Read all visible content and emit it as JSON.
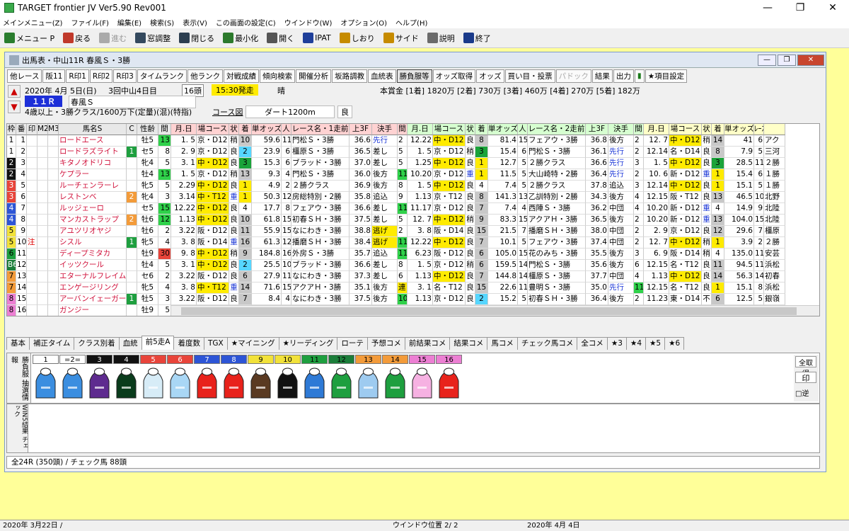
{
  "window": {
    "title": "TARGET frontier JV  Ver5.90  Rev001"
  },
  "menu": [
    "メインメニュー(Z)",
    "ファイル(F)",
    "編集(E)",
    "検索(S)",
    "表示(V)",
    "この画面の設定(C)",
    "ウインドウ(W)",
    "オプション(O)",
    "ヘルプ(H)"
  ],
  "toolbar": [
    {
      "label": "メニュー P",
      "icon": "menu-icon",
      "color": "#2a7d2e"
    },
    {
      "label": "戻る",
      "icon": "back-arrow-icon",
      "color": "#c0392b"
    },
    {
      "label": "進む",
      "icon": "forward-arrow-icon",
      "color": "#aaaaaa",
      "disabled": true
    },
    {
      "label": "窓調整",
      "icon": "window-adjust-icon",
      "color": "#34495e"
    },
    {
      "label": "閉じる",
      "icon": "close-window-icon",
      "color": "#2c3e50"
    },
    {
      "label": "最小化",
      "icon": "minimize-icon",
      "color": "#2c7a2c"
    },
    {
      "label": "開く",
      "icon": "open-icon",
      "color": "#555555"
    },
    {
      "label": "IPAT",
      "icon": "ipat-icon",
      "color": "#1f3f9a"
    },
    {
      "label": "しおり",
      "icon": "bookmark-icon",
      "color": "#c68b00"
    },
    {
      "label": "サイド",
      "icon": "side-icon",
      "color": "#c68b00"
    },
    {
      "label": "説明",
      "icon": "help-icon",
      "color": "#6b6b6b"
    },
    {
      "label": "終了",
      "icon": "exit-icon",
      "color": "#1a3a8a"
    }
  ],
  "child": {
    "title": "出馬表・中山11R 春風Ｓ・3勝"
  },
  "buttons": [
    "他レース",
    "阪11",
    "R印1",
    "R印2",
    "R印3",
    "タイムランク",
    "他ランク",
    "対戦成績",
    "傾向検索",
    "開催分析",
    "坂路調教",
    "血統表",
    "勝負服等",
    "オッズ取得",
    "オッズ",
    "買い目・投票",
    "パドック",
    "結果",
    "出力",
    "★項目設定"
  ],
  "race": {
    "date": "2020年 4月 5日(日)",
    "kai": "3回中山4日目",
    "heads": "16頭",
    "post": "15:30発走",
    "weather": "晴",
    "rno": "１１Ｒ",
    "name": "春風Ｓ",
    "cond": "4歳以上・3勝クラス/1600万下(定量)(混)(特指)",
    "course_label": "コース図",
    "course": "ダート1200m",
    "baba": "良",
    "prize": "本賞金 [1着] 1820万 [2着] 730万 [3着] 460万 [4着] 270万 [5着] 182万"
  },
  "colors": {
    "waku": [
      "#ffffff",
      "#ffffff",
      "#111111",
      "#111111",
      "#e8443a",
      "#e8443a",
      "#2d55d6",
      "#2d55d6",
      "#f2e23a",
      "#f2e23a",
      "#1e9f3f",
      "#1b7e3a",
      "#f39b3a",
      "#f39b3a",
      "#ec7fd3",
      "#ec7fd3"
    ]
  },
  "columns": {
    "left": [
      "枠",
      "番",
      "印",
      "M2",
      "M3",
      "馬名S",
      "C",
      "性齢",
      "間"
    ],
    "past1": [
      "月.日",
      "場コース",
      "状",
      "着",
      "単オッズ",
      "人",
      "レース名・1走前",
      "上3F",
      "決手",
      "間"
    ],
    "past2": [
      "月.日",
      "場コース",
      "状",
      "着",
      "単オッズ",
      "人",
      "レース名・2走前",
      "上3F",
      "決手",
      "間"
    ],
    "past3": [
      "月.日",
      "場コース",
      "状",
      "着",
      "単オッズ",
      "ﾚｰｽ"
    ]
  },
  "horses": [
    {
      "waku": "1",
      "ban": "1",
      "mark": "",
      "name": "ロードエース",
      "c": "",
      "sex": "牡5",
      "iv": "13",
      "p1": [
        "1. 5",
        "京・D12",
        "稍",
        "10",
        "59.6",
        "11",
        "門松Ｓ・3勝",
        "36.6",
        "先行",
        "2"
      ],
      "p2": [
        "12.22",
        "中・D12",
        "良",
        "8",
        "81.4",
        "15",
        "フェアウ・3勝",
        "36.8",
        "後方",
        "2"
      ],
      "p3": [
        "12. 7",
        "中・D12",
        "稍",
        "14",
        "41",
        "6",
        "アク"
      ]
    },
    {
      "waku": "1",
      "ban": "2",
      "mark": "",
      "name": "ロードラズライト",
      "c": "1",
      "sex": "セ5",
      "iv": "8",
      "p1": [
        "2. 9",
        "京・D12",
        "良",
        "2",
        "23.9",
        "6",
        "橿原Ｓ・3勝",
        "36.5",
        "差し",
        "5"
      ],
      "p2": [
        "1. 5",
        "京・D12",
        "稍",
        "3",
        "15.4",
        "6",
        "門松Ｓ・3勝",
        "36.1",
        "先行",
        "2"
      ],
      "p3": [
        "12.14",
        "名・D14",
        "良",
        "8",
        "7.9",
        "5",
        "三河"
      ]
    },
    {
      "waku": "2",
      "ban": "3",
      "mark": "",
      "name": "キタノオドリコ",
      "c": "",
      "sex": "牝4",
      "iv": "5",
      "p1": [
        "3. 1",
        "中・D12",
        "良",
        "3",
        "15.3",
        "6",
        "ブラッド・3勝",
        "37.0",
        "差し",
        "5"
      ],
      "p2": [
        "1.25",
        "中・D12",
        "良",
        "1",
        "12.7",
        "5",
        "２勝クラス",
        "36.6",
        "先行",
        "3"
      ],
      "p3": [
        "1. 5",
        "中・D12",
        "良",
        "3",
        "28.5",
        "11",
        "２勝"
      ]
    },
    {
      "waku": "2",
      "ban": "4",
      "mark": "",
      "name": "ケプラー",
      "c": "",
      "sex": "牡4",
      "iv": "13",
      "p1": [
        "1. 5",
        "京・D12",
        "稍",
        "13",
        "9.3",
        "4",
        "門松Ｓ・3勝",
        "36.0",
        "後方",
        "11"
      ],
      "p2": [
        "10.20",
        "京・D12",
        "重",
        "1",
        "11.5",
        "5",
        "大山崎特・2勝",
        "36.4",
        "先行",
        "2"
      ],
      "p3": [
        "10. 6",
        "新・D12",
        "重",
        "1",
        "15.4",
        "6",
        "１勝"
      ]
    },
    {
      "waku": "3",
      "ban": "5",
      "mark": "",
      "name": "ルーチェンラーレ",
      "c": "",
      "sex": "牝5",
      "iv": "5",
      "p1": [
        "2.29",
        "中・D12",
        "良",
        "1",
        "4.9",
        "2",
        "２勝クラス",
        "36.9",
        "後方",
        "8"
      ],
      "p2": [
        "1. 5",
        "中・D12",
        "良",
        "4",
        "7.4",
        "5",
        "２勝クラス",
        "37.8",
        "追込",
        "3"
      ],
      "p3": [
        "12.14",
        "中・D12",
        "良",
        "1",
        "15.1",
        "5",
        "１勝"
      ]
    },
    {
      "waku": "3",
      "ban": "6",
      "mark": "",
      "name": "レストンベ",
      "c": "2",
      "sex": "牝4",
      "iv": "3",
      "p1": [
        "3.14",
        "中・T12",
        "重",
        "1",
        "50.3",
        "12",
        "房総特別・2勝",
        "35.8",
        "追込",
        "9"
      ],
      "p2": [
        "1.13",
        "京・T12",
        "良",
        "8",
        "141.3",
        "13",
        "乙訓特別・2勝",
        "34.3",
        "後方",
        "4"
      ],
      "p3": [
        "12.15",
        "阪・T12",
        "良",
        "13",
        "46.5",
        "10",
        "北野"
      ]
    },
    {
      "waku": "4",
      "ban": "7",
      "mark": "",
      "name": "ルッジェーロ",
      "c": "",
      "sex": "セ5",
      "iv": "15",
      "p1": [
        "12.22",
        "中・D12",
        "良",
        "4",
        "17.7",
        "8",
        "フェアウ・3勝",
        "36.6",
        "差し",
        "11"
      ],
      "p2": [
        "11.17",
        "京・D12",
        "良",
        "7",
        "7.4",
        "4",
        "西陣Ｓ・3勝",
        "36.2",
        "中団",
        "4"
      ],
      "p3": [
        "10.20",
        "新・D12",
        "重",
        "4",
        "14.9",
        "9",
        "北陸"
      ]
    },
    {
      "waku": "4",
      "ban": "8",
      "mark": "",
      "name": "マンカストラップ",
      "c": "2",
      "sex": "牡6",
      "iv": "12",
      "p1": [
        "1.13",
        "中・D12",
        "良",
        "10",
        "61.8",
        "15",
        "初春ＳＨ・3勝",
        "37.5",
        "差し",
        "5"
      ],
      "p2": [
        "12. 7",
        "中・D12",
        "稍",
        "9",
        "83.3",
        "15",
        "アクアＨ・3勝",
        "36.5",
        "後方",
        "2"
      ],
      "p3": [
        "10.20",
        "新・D12",
        "重",
        "13",
        "104.0",
        "15",
        "北陸"
      ]
    },
    {
      "waku": "5",
      "ban": "9",
      "mark": "",
      "name": "アユツリオヤジ",
      "c": "",
      "sex": "牡6",
      "iv": "2",
      "p1": [
        "3.22",
        "阪・D12",
        "良",
        "11",
        "55.9",
        "15",
        "なにわき・3勝",
        "38.8",
        "逃げ",
        "2"
      ],
      "p2": [
        "3. 8",
        "阪・D14",
        "良",
        "15",
        "21.5",
        "7",
        "播磨ＳＨ・3勝",
        "38.0",
        "中団",
        "2"
      ],
      "p3": [
        "2. 9",
        "京・D12",
        "良",
        "12",
        "29.6",
        "7",
        "橿原"
      ]
    },
    {
      "waku": "5",
      "ban": "10",
      "mark": "注",
      "name": "シスル",
      "c": "1",
      "sex": "牝5",
      "iv": "4",
      "p1": [
        "3. 8",
        "阪・D14",
        "重",
        "16",
        "61.3",
        "12",
        "播磨ＳＨ・3勝",
        "38.4",
        "逃げ",
        "11"
      ],
      "p2": [
        "12.22",
        "中・D12",
        "良",
        "7",
        "10.1",
        "5",
        "フェアウ・3勝",
        "37.4",
        "中団",
        "2"
      ],
      "p3": [
        "12. 7",
        "中・D12",
        "稍",
        "1",
        "3.9",
        "2",
        "２勝"
      ]
    },
    {
      "waku": "6",
      "ban": "11",
      "mark": "",
      "name": "ディープミタカ",
      "c": "",
      "sex": "牡9",
      "iv": "30",
      "p1": [
        "9. 8",
        "中・D12",
        "稍",
        "9",
        "184.8",
        "16",
        "外房Ｓ・3勝",
        "35.7",
        "追込",
        "11"
      ],
      "p2": [
        "6.23",
        "阪・D12",
        "良",
        "6",
        "105.0",
        "15",
        "花のみち・3勝",
        "35.5",
        "後方",
        "3"
      ],
      "p3": [
        "6. 9",
        "阪・D14",
        "稍",
        "4",
        "135.0",
        "11",
        "安芸"
      ]
    },
    {
      "waku": "B6",
      "ban": "12",
      "mark": "",
      "name": "イッツクール",
      "c": "",
      "sex": "牡4",
      "iv": "5",
      "p1": [
        "3. 1",
        "中・D12",
        "良",
        "2",
        "25.5",
        "10",
        "ブラッド・3勝",
        "36.6",
        "差し",
        "8"
      ],
      "p2": [
        "1. 5",
        "京・D12",
        "稍",
        "6",
        "159.5",
        "14",
        "門松Ｓ・3勝",
        "35.6",
        "後方",
        "6"
      ],
      "p3": [
        "12.15",
        "名・T12",
        "良",
        "11",
        "94.5",
        "11",
        "浜松"
      ]
    },
    {
      "waku": "7",
      "ban": "13",
      "mark": "",
      "name": "エターナルフレイム",
      "c": "",
      "sex": "セ6",
      "iv": "2",
      "p1": [
        "3.22",
        "阪・D12",
        "良",
        "6",
        "27.9",
        "11",
        "なにわき・3勝",
        "37.3",
        "差し",
        "6"
      ],
      "p2": [
        "1.13",
        "中・D12",
        "良",
        "7",
        "144.8",
        "14",
        "橿原Ｓ・3勝",
        "37.7",
        "中団",
        "4"
      ],
      "p3": [
        "1.13",
        "中・D12",
        "良",
        "14",
        "56.3",
        "14",
        "初春"
      ]
    },
    {
      "waku": "7",
      "ban": "14",
      "mark": "",
      "name": "エンゲージリング",
      "c": "",
      "sex": "牝5",
      "iv": "4",
      "p1": [
        "3. 8",
        "中・T12",
        "重",
        "14",
        "71.6",
        "15",
        "アクアＨ・3勝",
        "35.1",
        "後方",
        "連"
      ],
      "p2": [
        "3. 1",
        "名・T12",
        "良",
        "15",
        "22.6",
        "11",
        "豊明Ｓ・3勝",
        "35.0",
        "先行",
        "11"
      ],
      "p3": [
        "12.15",
        "名・T12",
        "良",
        "1",
        "15.1",
        "8",
        "浜松"
      ]
    },
    {
      "waku": "8",
      "ban": "15",
      "mark": "",
      "name": "アーバンイェーガー",
      "c": "1",
      "sex": "牡5",
      "iv": "3",
      "p1": [
        "3.22",
        "阪・D12",
        "良",
        "7",
        "8.4",
        "4",
        "なにわき・3勝",
        "37.5",
        "後方",
        "10"
      ],
      "p2": [
        "1.13",
        "京・D12",
        "良",
        "2",
        "15.2",
        "5",
        "初春ＳＨ・3勝",
        "36.4",
        "後方",
        "2"
      ],
      "p3": [
        "11.23",
        "東・D14",
        "不",
        "6",
        "12.5",
        "5",
        "銀嶺"
      ]
    },
    {
      "waku": "8",
      "ban": "16",
      "mark": "",
      "name": "ガンジー",
      "c": "",
      "sex": "牡9",
      "iv": "5",
      "p1": [
        "3. 1",
        "中・D12",
        "良",
        "5",
        "121.0",
        "13",
        "ブラッド・3勝",
        "36.3",
        "後方",
        "6"
      ],
      "p2": [
        "1.18",
        "京・D14",
        "稍",
        "8",
        "179.8",
        "15",
        "羅生門Ｈ・3勝",
        "37.2",
        "中団",
        "2"
      ],
      "p3": [
        "12. 7",
        "中・D12",
        "稍",
        "7",
        "255.2",
        "16",
        "アク"
      ]
    }
  ],
  "tabs": [
    "基本",
    "補正タイム",
    "クラス別着",
    "血統",
    "前5走A",
    "着度数",
    "TGX",
    "★マイニング",
    "★リーディング",
    "ローテ",
    "予想コメ",
    "前結果コメ",
    "結果コメ",
    "馬コメ",
    "チェック馬コメ",
    "全コメ",
    "★3",
    "★4",
    "★5",
    "★6"
  ],
  "silks_label": "勝負服 抽選情報",
  "silk_nums": [
    "1",
    "=2=",
    "3",
    "4",
    "5",
    "6",
    "7",
    "8",
    "9",
    "10",
    "11",
    "12",
    "13",
    "14",
    "15",
    "16"
  ],
  "silk_panel": {
    "get_all": "全取得",
    "close": "×",
    "mark": "印",
    "popular": "人気",
    "reverse": "逆",
    "small": "小"
  },
  "check_label": "WIN5結果 チェック",
  "status2": "全24R (350頭)  / チェック馬 88頭",
  "statusbar": {
    "left": "2020年 3月22日 /",
    "mid": "ウインドウ位置 2/ 2",
    "right": "2020年 4月 4日"
  }
}
